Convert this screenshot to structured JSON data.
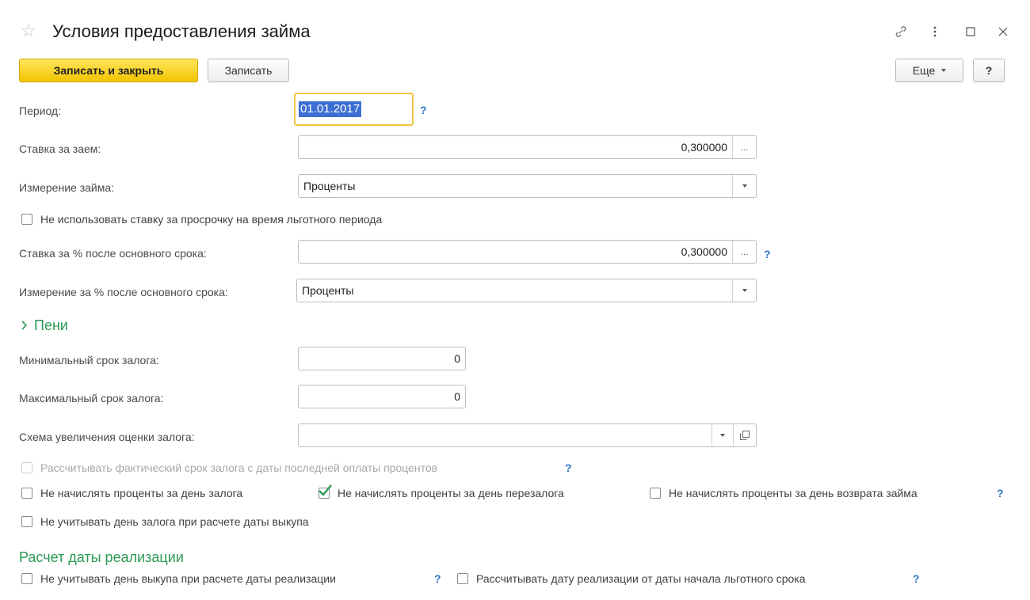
{
  "window": {
    "title": "Условия предоставления займа",
    "star_icon": "star-icon",
    "link_icon": "link-icon",
    "more_icon": "more-vertical-icon",
    "maximize_icon": "maximize-icon",
    "close_icon": "close-icon"
  },
  "toolbar": {
    "save_close_label": "Записать и закрыть",
    "save_label": "Записать",
    "more_label": "Еще",
    "help_label": "?"
  },
  "form": {
    "period_label": "Период:",
    "period_value": "01.01.2017",
    "rate_label": "Ставка за заем:",
    "rate_value": "0,300000",
    "rate_unit_label": "Измерение займа:",
    "rate_unit_value": "Проценты",
    "no_overdue_rate_label": "Не использовать ставку за просрочку на время льготного периода",
    "rate_after_label": "Ставка за % после основного срока:",
    "rate_after_value": "0,300000",
    "rate_after_unit_label": "Измерение за % после основного срока:",
    "rate_after_unit_value": "Проценты",
    "penalties_section": "Пени",
    "min_term_label": "Минимальный срок залога:",
    "min_term_value": "0",
    "max_term_label": "Максимальный срок залога:",
    "max_term_value": "0",
    "scheme_label": "Схема увеличения оценки залога:",
    "scheme_value": "",
    "calc_actual_term_label": "Рассчитывать фактический срок залога с даты последней оплаты процентов",
    "no_interest_pledge_day_label": "Не начислять проценты за день залога",
    "no_interest_repledge_day_label": "Не начислять проценты за день перезалога",
    "no_interest_return_day_label": "Не начислять проценты за день возврата займа",
    "no_pledge_day_buyout_label": "Не учитывать день залога при расчете даты выкупа",
    "realization_section": "Расчет даты реализации",
    "no_buyout_day_label": "Не учитывать день выкупа при расчете даты реализации",
    "calc_from_grace_label": "Рассчитывать дату реализации от даты начала льготного срока",
    "ellipsis": "...",
    "help_mark": "?"
  },
  "checkboxes": {
    "no_overdue_rate": false,
    "calc_actual_term": false,
    "no_interest_pledge_day": false,
    "no_interest_repledge_day": true,
    "no_interest_return_day": false,
    "no_pledge_day_buyout": false,
    "no_buyout_day": false,
    "calc_from_grace": false
  },
  "colors": {
    "primary_button": "#f2c400",
    "section_header": "#2b9a54",
    "help_mark": "#2f74c8",
    "focus_border": "#f4c542",
    "selection": "#3c6fd1",
    "checkmark": "#2b9a54"
  }
}
